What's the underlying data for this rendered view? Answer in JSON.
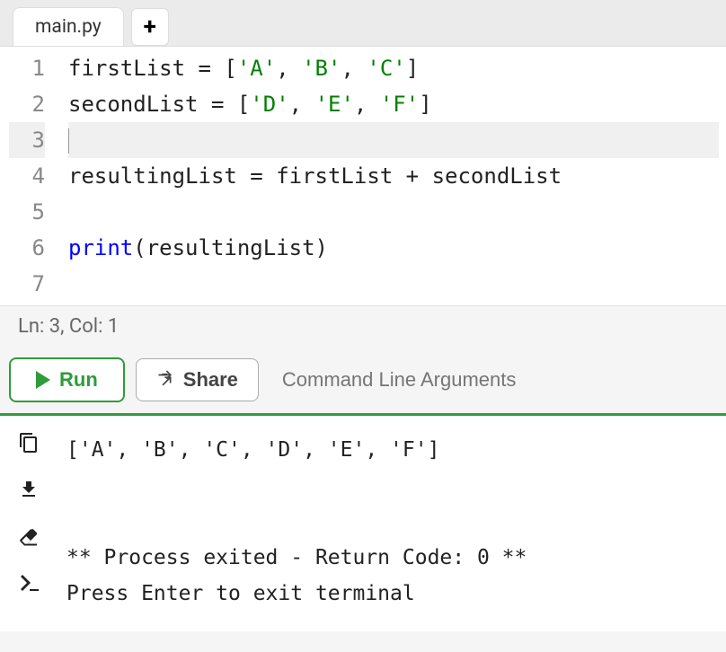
{
  "tabs": {
    "active": "main.py"
  },
  "editor": {
    "lines": [
      {
        "num": 1,
        "segments": [
          {
            "t": "plain",
            "v": "firstList = ["
          },
          {
            "t": "str",
            "v": "'A'"
          },
          {
            "t": "plain",
            "v": ", "
          },
          {
            "t": "str",
            "v": "'B'"
          },
          {
            "t": "plain",
            "v": ", "
          },
          {
            "t": "str",
            "v": "'C'"
          },
          {
            "t": "plain",
            "v": "]"
          }
        ]
      },
      {
        "num": 2,
        "segments": [
          {
            "t": "plain",
            "v": "secondList = ["
          },
          {
            "t": "str",
            "v": "'D'"
          },
          {
            "t": "plain",
            "v": ", "
          },
          {
            "t": "str",
            "v": "'E'"
          },
          {
            "t": "plain",
            "v": ", "
          },
          {
            "t": "str",
            "v": "'F'"
          },
          {
            "t": "plain",
            "v": "]"
          }
        ]
      },
      {
        "num": 3,
        "active": true,
        "segments": []
      },
      {
        "num": 4,
        "segments": [
          {
            "t": "plain",
            "v": "resultingList = firstList + secondList"
          }
        ]
      },
      {
        "num": 5,
        "segments": []
      },
      {
        "num": 6,
        "segments": [
          {
            "t": "builtin",
            "v": "print"
          },
          {
            "t": "plain",
            "v": "(resultingList)"
          }
        ]
      },
      {
        "num": 7,
        "segments": []
      }
    ]
  },
  "status": {
    "text": "Ln: 3,  Col: 1"
  },
  "toolbar": {
    "run_label": "Run",
    "share_label": "Share",
    "cli_placeholder": "Command Line Arguments"
  },
  "output": {
    "lines": [
      "['A', 'B', 'C', 'D', 'E', 'F']",
      "",
      "",
      "** Process exited - Return Code: 0 **",
      "Press Enter to exit terminal"
    ]
  }
}
